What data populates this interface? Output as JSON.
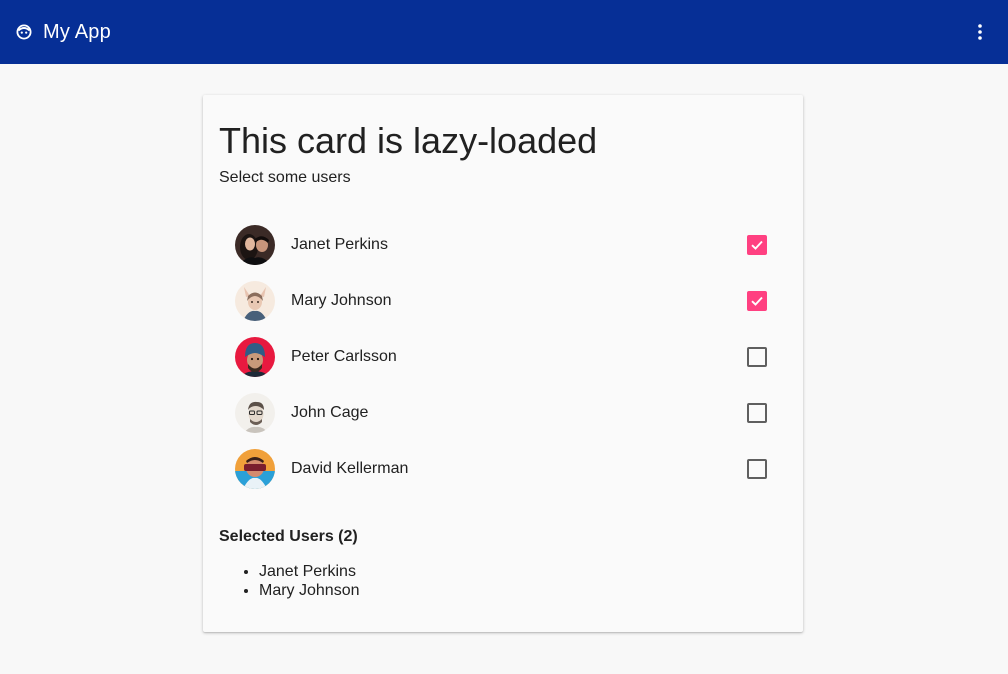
{
  "toolbar": {
    "logo_icon": "app-face-icon",
    "title": "My App",
    "menu_icon": "more-vert-icon",
    "background": "#062f96"
  },
  "card": {
    "title": "This card is lazy-loaded",
    "subtitle": "Select some users"
  },
  "users": [
    {
      "name": "Janet Perkins",
      "checked": true
    },
    {
      "name": "Mary Johnson",
      "checked": true
    },
    {
      "name": "Peter Carlsson",
      "checked": false
    },
    {
      "name": "John Cage",
      "checked": false
    },
    {
      "name": "David Kellerman",
      "checked": false
    }
  ],
  "selected": {
    "heading": "Selected Users (2)",
    "items": [
      "Janet Perkins",
      "Mary Johnson"
    ]
  },
  "colors": {
    "accent": "#ff4081",
    "checkbox_border": "#5f5f5f"
  }
}
